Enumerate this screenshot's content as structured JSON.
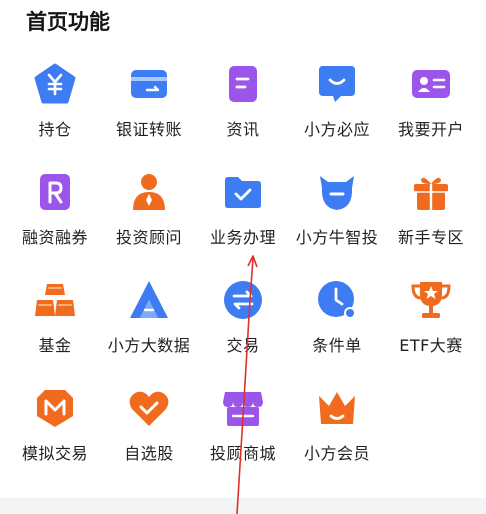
{
  "section_title": "首页功能",
  "items": [
    {
      "label": "持仓",
      "icon": "yuan-pentagon-icon",
      "color": "#3d7cf2"
    },
    {
      "label": "银证转账",
      "icon": "card-icon",
      "color": "#3d7cf2"
    },
    {
      "label": "资讯",
      "icon": "document-icon",
      "color": "#9b55ea"
    },
    {
      "label": "小方必应",
      "icon": "chat-bubble-icon",
      "color": "#3d7cf2"
    },
    {
      "label": "我要开户",
      "icon": "id-card-icon",
      "color": "#9b55ea"
    },
    {
      "label": "融资融券",
      "icon": "r-badge-icon",
      "color": "#9b55ea"
    },
    {
      "label": "投资顾问",
      "icon": "advisor-person-icon",
      "color": "#f06b1e"
    },
    {
      "label": "业务办理",
      "icon": "folder-check-icon",
      "color": "#3d7cf2"
    },
    {
      "label": "小方牛智投",
      "icon": "bull-icon",
      "color": "#3d7cf2"
    },
    {
      "label": "新手专区",
      "icon": "gift-icon",
      "color": "#f06b1e"
    },
    {
      "label": "基金",
      "icon": "gold-bars-icon",
      "color": "#f06b1e"
    },
    {
      "label": "小方大数据",
      "icon": "a-logo-icon",
      "color": "#3d7cf2"
    },
    {
      "label": "交易",
      "icon": "exchange-circle-icon",
      "color": "#3d7cf2"
    },
    {
      "label": "条件单",
      "icon": "clock-icon",
      "color": "#3d7cf2"
    },
    {
      "label": "ETF大赛",
      "icon": "trophy-icon",
      "color": "#f06b1e"
    },
    {
      "label": "模拟交易",
      "icon": "m-shield-icon",
      "color": "#f06b1e"
    },
    {
      "label": "自选股",
      "icon": "heart-check-icon",
      "color": "#f06b1e"
    },
    {
      "label": "投顾商城",
      "icon": "shop-icon",
      "color": "#9b55ea"
    },
    {
      "label": "小方会员",
      "icon": "crown-icon",
      "color": "#f06b1e"
    }
  ]
}
